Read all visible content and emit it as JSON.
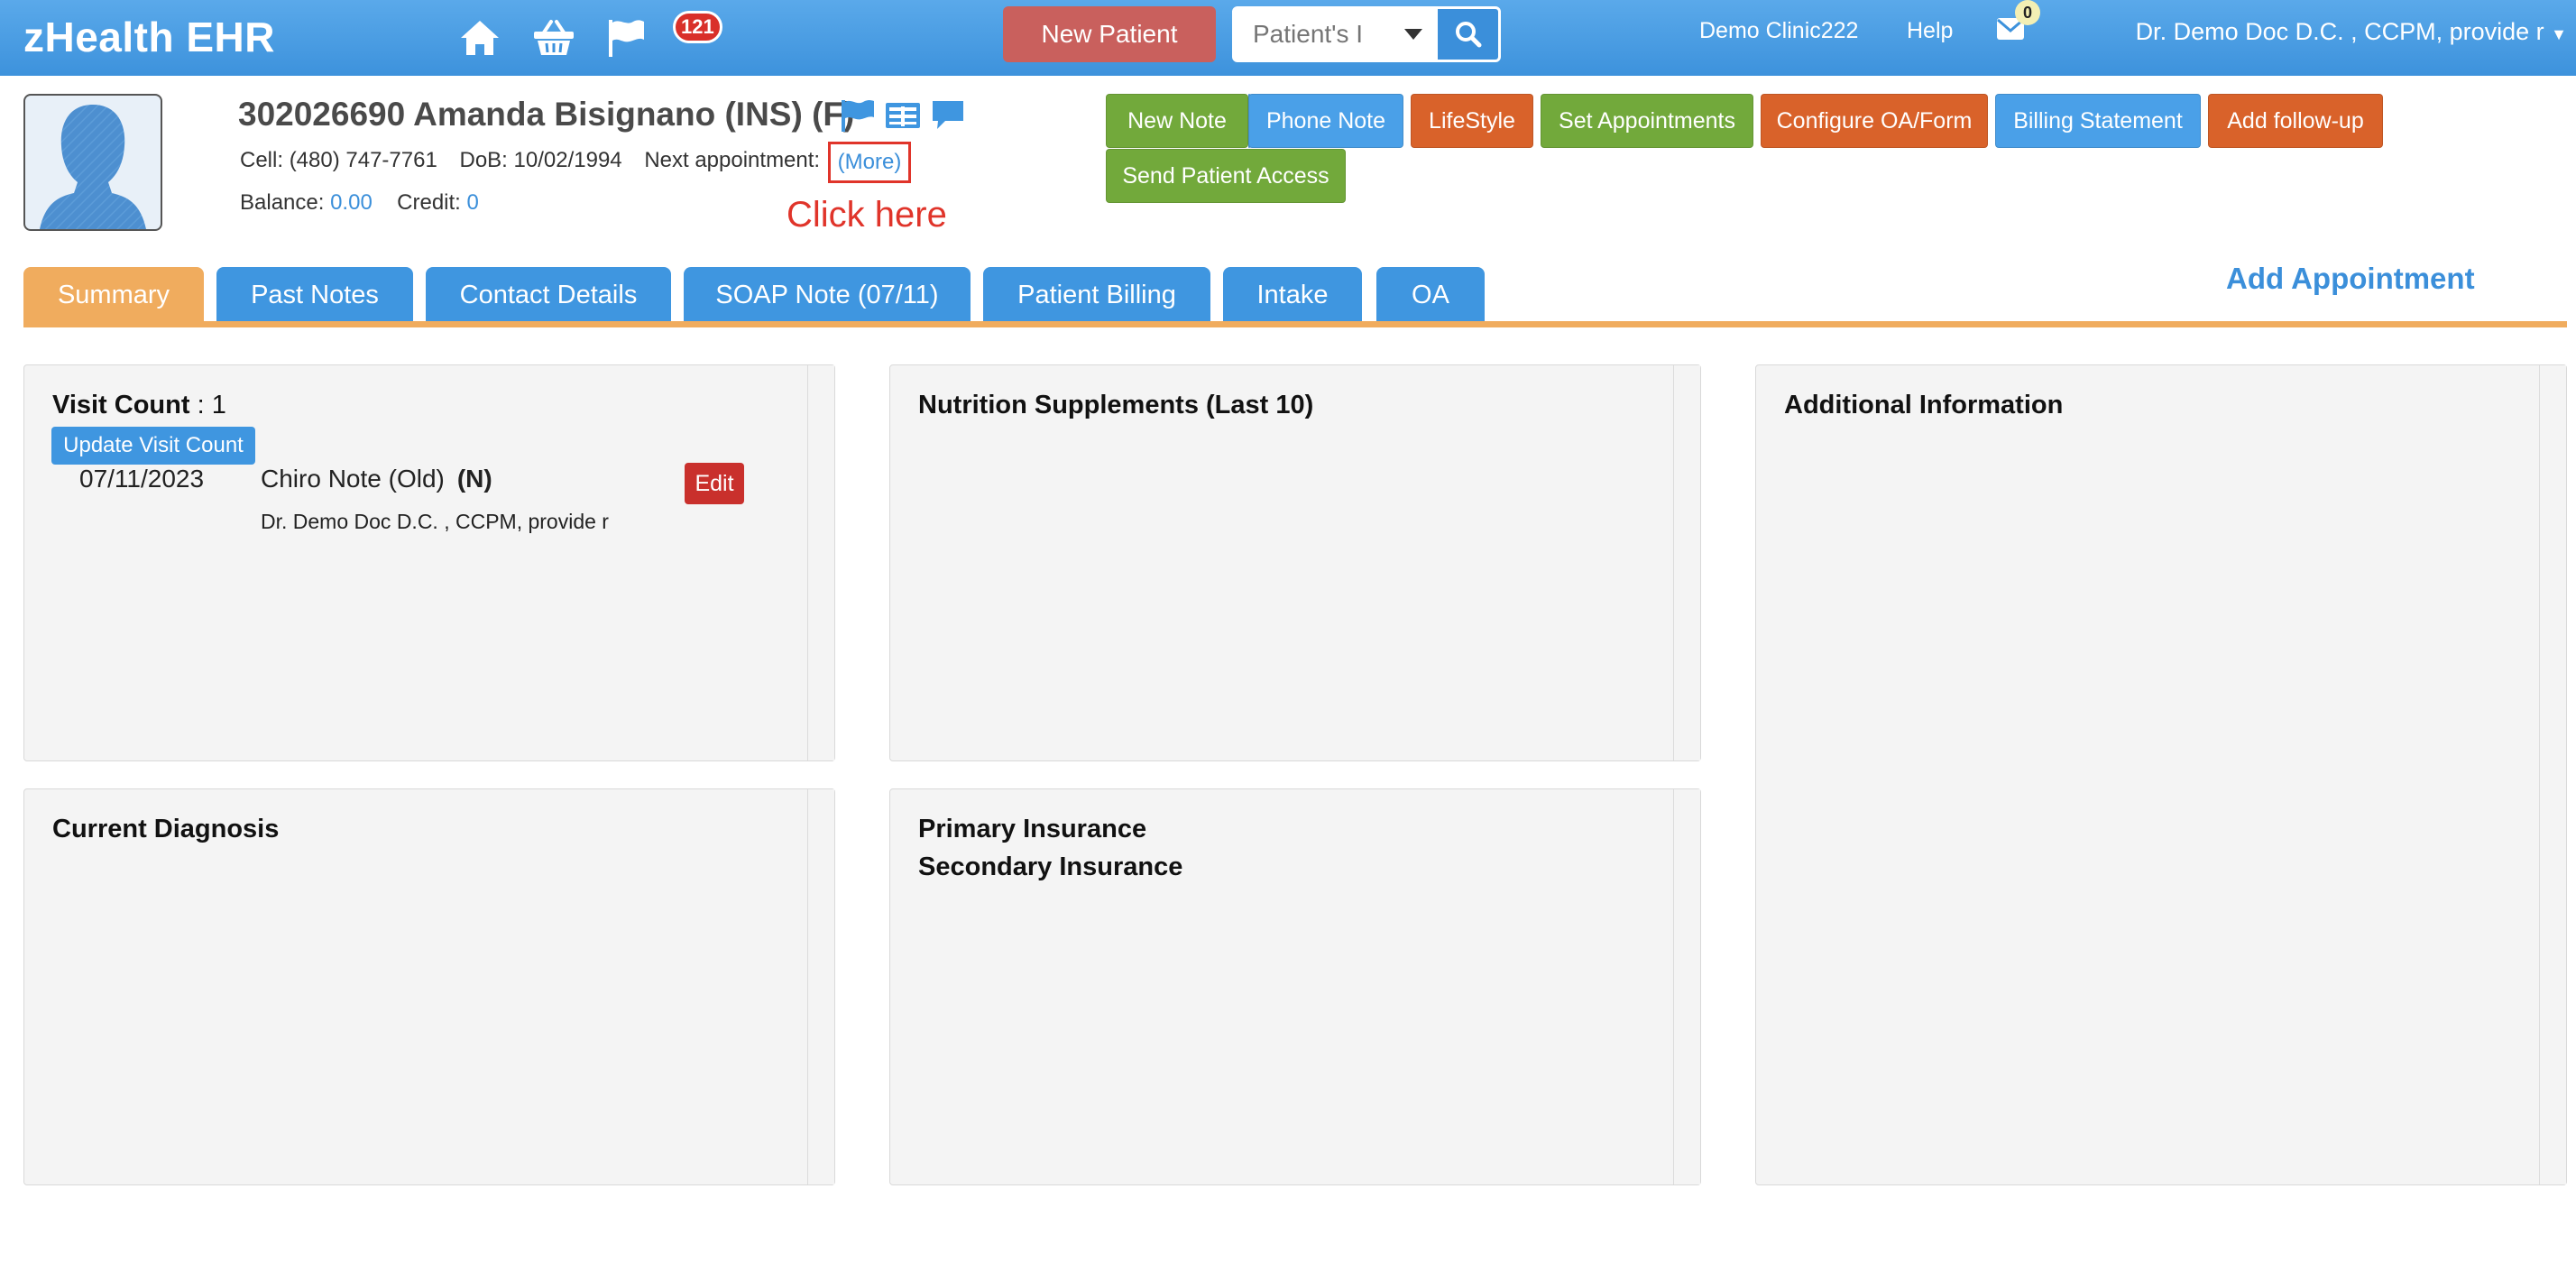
{
  "app": {
    "brand": "zHealth EHR",
    "notification_count": "121",
    "new_patient_label": "New Patient",
    "search_placeholder": "Patient's I",
    "clinic_link": "Demo Clinic222",
    "help_link": "Help",
    "mail_count": "0",
    "user_menu": "Dr. Demo Doc D.C. , CCPM, provide r"
  },
  "nav_icons": [
    "home-icon",
    "basket-icon",
    "flag-icon"
  ],
  "patient": {
    "title": "302026690 Amanda Bisignano  (INS) (F)",
    "cell_label": "Cell:",
    "cell": "(480) 747-7761",
    "dob_label": "DoB:",
    "dob": "10/02/1994",
    "next_appt_label": "Next appointment:",
    "more_link": "(More)",
    "annotation": "Click here",
    "balance_label": "Balance:",
    "balance": "0.00",
    "credit_label": "Credit:",
    "credit": "0",
    "header_icons": [
      "flag-icon",
      "id-card-icon",
      "chat-icon"
    ]
  },
  "actions": {
    "new_note": "New Note",
    "phone_note": "Phone Note",
    "lifestyle": "LifeStyle",
    "set_appointments": "Set Appointments",
    "configure_oa": "Configure OA/Form",
    "billing_statement": "Billing Statement",
    "add_followup": "Add follow-up",
    "send_patient_access": "Send Patient Access"
  },
  "colors": {
    "topbar": "#4a9fe6",
    "tab_active": "#f0ac5e",
    "tab": "#3f96e0",
    "green_button": "#72a93b",
    "orange_button": "#d9622a",
    "annotation_red": "#e0342a"
  },
  "tabs": [
    {
      "label": "Summary",
      "active": true
    },
    {
      "label": "Past Notes",
      "active": false
    },
    {
      "label": "Contact Details",
      "active": false
    },
    {
      "label": "SOAP Note (07/11)",
      "active": false
    },
    {
      "label": "Patient Billing",
      "active": false
    },
    {
      "label": "Intake",
      "active": false
    },
    {
      "label": "OA",
      "active": false
    }
  ],
  "add_appointment": "Add Appointment",
  "panels": {
    "visits": {
      "count_label": "Visit Count",
      "count_sep": " : ",
      "count": "1",
      "update_button": "Update Visit Count",
      "notes": [
        {
          "date": "07/11/2023",
          "type": "Chiro Note (Old)",
          "flag": "(N)",
          "provider": "Dr. Demo Doc D.C. , CCPM, provide r",
          "edit_label": "Edit"
        }
      ]
    },
    "nutrition": {
      "title": "Nutrition Supplements (Last 10)"
    },
    "additional": {
      "title": "Additional Information"
    },
    "diagnosis": {
      "title": "Current Diagnosis"
    },
    "insurance": {
      "primary": "Primary Insurance",
      "secondary": "Secondary Insurance"
    }
  }
}
